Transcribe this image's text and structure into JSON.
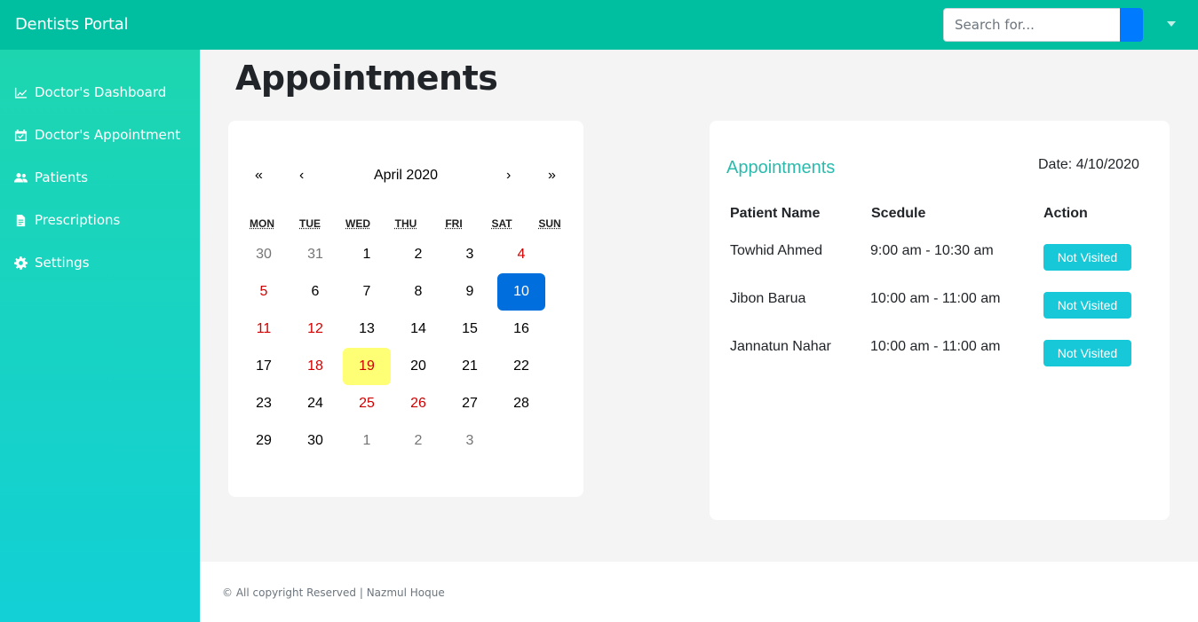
{
  "header": {
    "brand": "Dentists Portal",
    "search_placeholder": "Search for..."
  },
  "sidebar": {
    "items": [
      {
        "label": "Doctor's Dashboard",
        "icon": "chart-line-icon"
      },
      {
        "label": "Doctor's Appointment",
        "icon": "calendar-check-icon"
      },
      {
        "label": "Patients",
        "icon": "users-icon"
      },
      {
        "label": "Prescriptions",
        "icon": "file-icon"
      },
      {
        "label": "Settings",
        "icon": "gear-icon"
      }
    ]
  },
  "page": {
    "title": "Appointments"
  },
  "calendar": {
    "prev_year": "«",
    "prev_month": "‹",
    "next_month": "›",
    "next_year": "»",
    "month_label": "April 2020",
    "weekdays": [
      "MON",
      "TUE",
      "WED",
      "THU",
      "FRI",
      "SAT",
      "SUN"
    ],
    "weeks": [
      [
        "30",
        "31",
        "1",
        "2",
        "3",
        "4",
        ""
      ],
      [
        "5",
        "6",
        "7",
        "8",
        "9",
        "10",
        ""
      ],
      [
        "11",
        "12",
        "13",
        "14",
        "15",
        "16",
        ""
      ],
      [
        "17",
        "18",
        "19",
        "20",
        "21",
        "22",
        ""
      ],
      [
        "23",
        "24",
        "25",
        "26",
        "27",
        "28",
        ""
      ],
      [
        "29",
        "30",
        "1",
        "2",
        "3",
        "",
        ""
      ]
    ],
    "selected_day": "10",
    "today_day": "19",
    "colors": {
      "selected": "#006edc",
      "today": "#ffff76",
      "weekend": "#d10000",
      "neighbor": "#757575"
    }
  },
  "appointments": {
    "heading": "Appointments",
    "date_text": "Date: 4/10/2020",
    "columns": [
      "Patient Name",
      "Scedule",
      "Action"
    ],
    "rows": [
      {
        "patient": "Towhid Ahmed",
        "schedule": "9:00 am - 10:30 am",
        "action": "Not Visited"
      },
      {
        "patient": "Jibon Barua",
        "schedule": "10:00 am - 11:00 am",
        "action": "Not Visited"
      },
      {
        "patient": "Jannatun Nahar",
        "schedule": "10:00 am - 11:00 am",
        "action": "Not Visited"
      }
    ]
  },
  "footer": {
    "text": "© All copyright Reserved | Nazmul Hoque"
  },
  "colors": {
    "topbar": "#00bfa0",
    "sidebar_top": "#1dd6b0",
    "sidebar_bottom": "#12d0d6",
    "accent": "#2bbbad",
    "button": "#17c8d8"
  }
}
